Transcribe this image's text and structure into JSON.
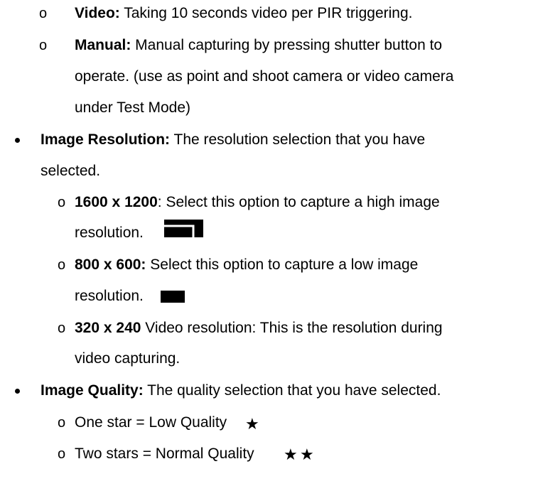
{
  "bullets": {
    "sub": "o"
  },
  "video": {
    "label": "Video:",
    "text": " Taking 10 seconds video per PIR triggering."
  },
  "manual": {
    "label": "Manual:",
    "text1": " Manual capturing by pressing shutter button to",
    "text2": "operate. (use as point and shoot camera or video camera",
    "text3": "under Test Mode)"
  },
  "image_resolution": {
    "label": "Image Resolution:",
    "text1": " The resolution selection that you have",
    "text2": "selected.",
    "options": [
      {
        "value": "1600 x 1200",
        "text1": ": Select this option to capture a high image",
        "text2": "resolution.",
        "icon": "high-resolution-icon"
      },
      {
        "value": "800 x 600:",
        "text1": " Select this option to capture a low image",
        "text2": "resolution.",
        "icon": "low-resolution-icon"
      },
      {
        "value": "320 x 240",
        "text1": " Video resolution: This is the resolution during",
        "text2": "video capturing."
      }
    ]
  },
  "image_quality": {
    "label": "Image Quality:",
    "text": " The quality selection that you have selected.",
    "options": [
      {
        "text": "One star = Low Quality",
        "stars": 1
      },
      {
        "text": "Two stars = Normal Quality",
        "stars": 2
      }
    ]
  },
  "icons": {
    "star_glyph": "★"
  }
}
